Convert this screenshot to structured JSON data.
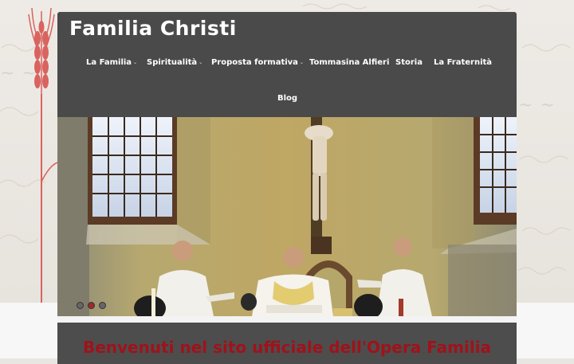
{
  "site": {
    "title": "Familia Christi"
  },
  "nav": {
    "items": [
      {
        "label": "La Familia",
        "has_dropdown": true
      },
      {
        "label": "Spiritualità",
        "has_dropdown": true
      },
      {
        "label": "Proposta formativa",
        "has_dropdown": true
      },
      {
        "label": "Tommasina Alfieri",
        "has_dropdown": false
      },
      {
        "label": "Storia",
        "has_dropdown": false
      },
      {
        "label": "La Fraternità",
        "has_dropdown": false
      },
      {
        "label": "Blog",
        "has_dropdown": false
      }
    ],
    "caret": "⌄"
  },
  "slider": {
    "slide_count": 3,
    "active_slide": 2
  },
  "welcome": {
    "heading": "Benvenuti nel sito ufficiale dell'Opera Familia"
  },
  "colors": {
    "header_bg": "#4a4a4a",
    "accent_red": "#a0121a"
  }
}
